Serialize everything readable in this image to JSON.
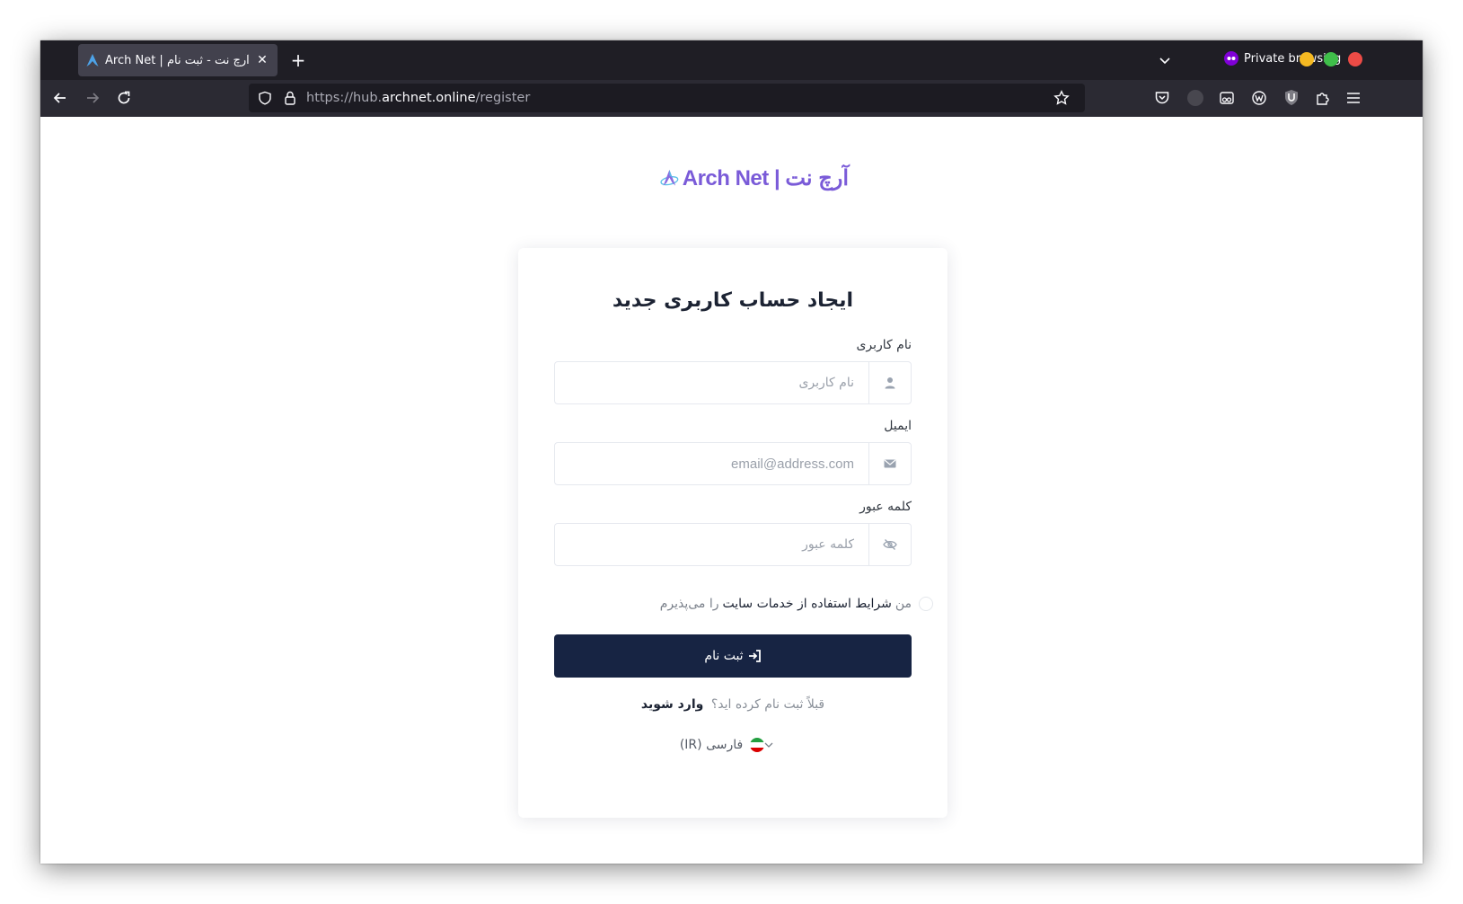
{
  "browser": {
    "tab_title": "Arch Net | آرچ نت - ثبت نام",
    "new_tab_label": "+",
    "private_label": "Private browsing",
    "url_prefix": "https://hub.",
    "url_domain": "archnet.online",
    "url_path": "/register"
  },
  "logo": {
    "text": "Arch Net | آرچ نت"
  },
  "form": {
    "title": "ایجاد حساب کاربری جدید",
    "username_label": "نام کاربری",
    "username_placeholder": "نام کاربری",
    "email_label": "ایمیل",
    "email_placeholder": "email@address.com",
    "password_label": "کلمه عبور",
    "password_placeholder": "کلمه عبور",
    "terms_prefix": "من",
    "terms_link": "شرایط استفاده از خدمات سایت",
    "terms_suffix": "را می‌پذیرم",
    "submit_label": "ثبت نام",
    "already_text": "قبلاً ثبت نام کرده اید؟",
    "login_link": "وارد شوید",
    "language": "فارسی (IR)"
  },
  "colors": {
    "primary": "#172443",
    "tabbar": "#1f1e25",
    "navbar": "#2b2a33",
    "logo": "#7a5bd8"
  },
  "icons": {
    "username": "user-icon",
    "email": "envelope-icon",
    "password": "eye-slash-icon",
    "submit": "sign-in-icon"
  }
}
